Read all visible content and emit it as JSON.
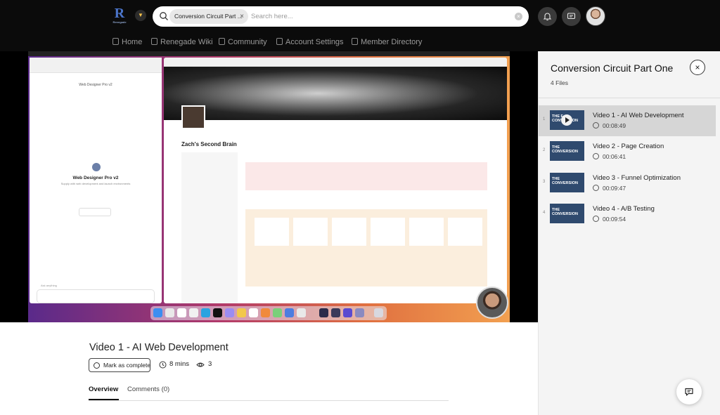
{
  "brand": {
    "logo_letter": "R",
    "logo_caption": "Renegade"
  },
  "search": {
    "chip_label": "Conversion Circuit Part ...",
    "chip_remove": "×",
    "placeholder": "Search here..."
  },
  "nav": {
    "items": [
      {
        "label": "Home",
        "icon": "home-icon"
      },
      {
        "label": "Renegade Wiki",
        "icon": "document-icon"
      },
      {
        "label": "Community",
        "icon": "community-icon"
      },
      {
        "label": "Account Settings",
        "icon": "document-icon"
      },
      {
        "label": "Member Directory",
        "icon": "people-icon"
      }
    ]
  },
  "video_screen": {
    "left_app_title": "Web Designer Pro v2",
    "left_app_subtitle": "Supply with web development and launch environments",
    "left_input_placeholder": "Ask anything",
    "notion_page_title": "Zach's Second Brain"
  },
  "lesson": {
    "title": "Video 1 - AI Web Development",
    "mark_complete_label": "Mark as complete",
    "duration": "8 mins",
    "views": "3",
    "tabs": [
      {
        "label": "Overview",
        "active": true
      },
      {
        "label": "Comments (0)",
        "active": false
      }
    ]
  },
  "playlist": {
    "title": "Conversion Circuit Part One",
    "file_count": "4 Files",
    "close_label": "×",
    "items": [
      {
        "number": "1",
        "title": "Video 1 - AI Web Development",
        "duration": "00:08:49",
        "active": true,
        "thumb_text": "THE F CONVERSION"
      },
      {
        "number": "2",
        "title": "Video 2 - Page Creation",
        "duration": "00:06:41",
        "active": false,
        "thumb_text": "THE CONVERSION"
      },
      {
        "number": "3",
        "title": "Video 3 - Funnel Optimization",
        "duration": "00:09:47",
        "active": false,
        "thumb_text": "THE CONVERSION"
      },
      {
        "number": "4",
        "title": "Video 4 - A/B Testing",
        "duration": "00:09:54",
        "active": false,
        "thumb_text": "THE CONVERSION"
      }
    ]
  },
  "colors": {
    "topbar_bg": "#0b0b0b",
    "panel_bg": "#f4f4f4",
    "active_item_bg": "#d6d6d6",
    "thumb_bg": "#2f4a6e"
  }
}
